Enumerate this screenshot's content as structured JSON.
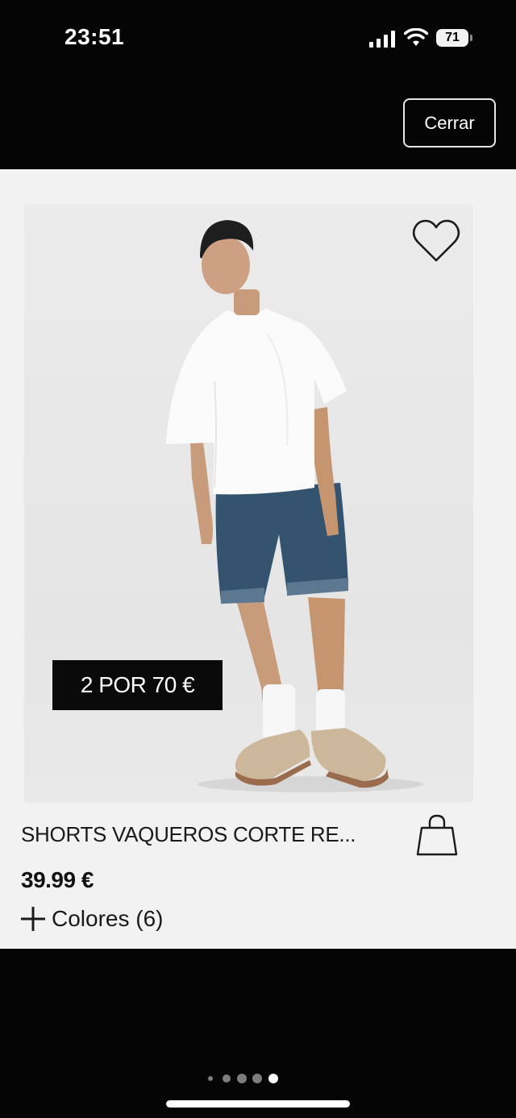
{
  "status_bar": {
    "time": "23:51",
    "battery": "71",
    "icons": [
      "signal-icon",
      "wifi-icon",
      "battery-icon"
    ]
  },
  "header": {
    "close_label": "Cerrar"
  },
  "product": {
    "promo": "2 POR 70 €",
    "name": "SHORTS VAQUEROS CORTE RE...",
    "price": "39.99 €",
    "colors_label": "Colores (6)",
    "icons": [
      "heart-icon",
      "shopping-bag-icon",
      "plus-icon"
    ]
  },
  "pagination": {
    "total": 5,
    "active_index": 4
  },
  "colors": {
    "background": "#050505",
    "card": "#f2f2f2",
    "badge": "#0a0a0a",
    "text": "#1a1a1a"
  }
}
